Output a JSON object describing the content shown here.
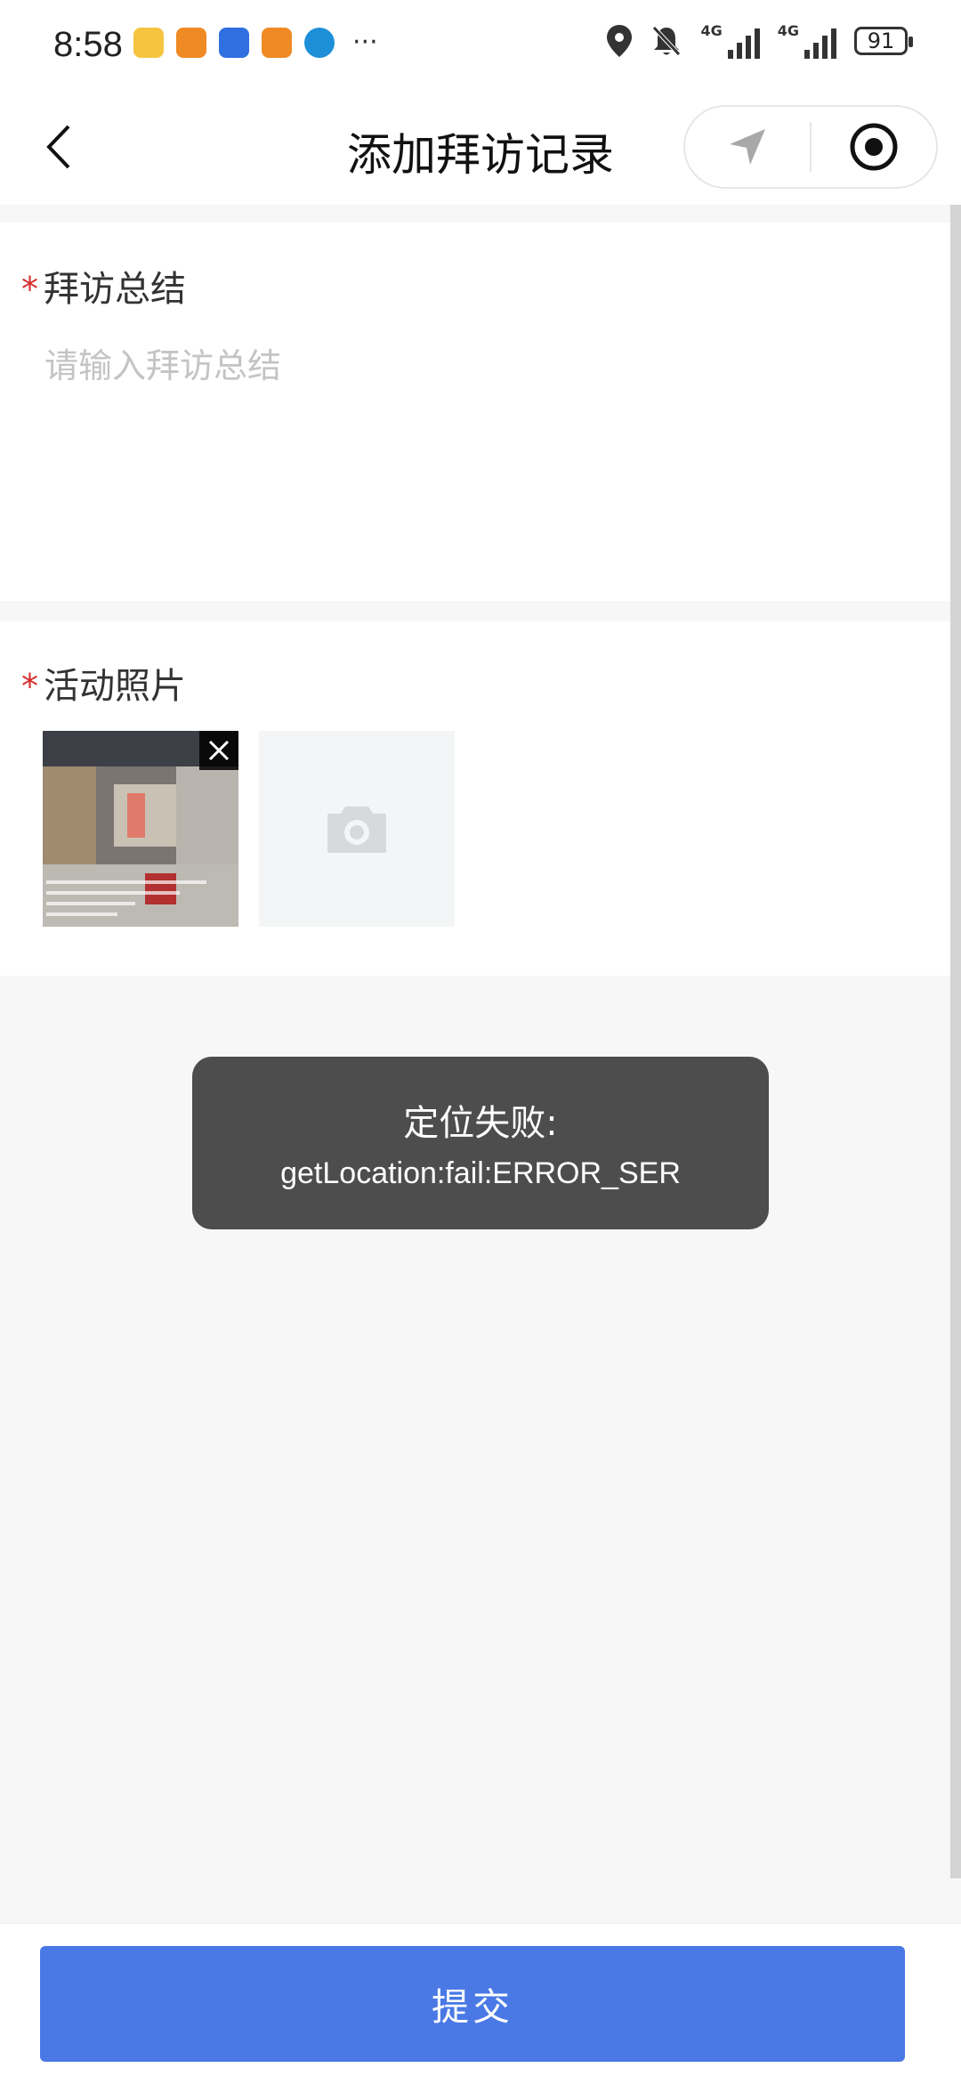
{
  "status_bar": {
    "time": "8:58",
    "network_1": "4G",
    "network_2": "4G",
    "battery": "91",
    "more_indicator": "···",
    "notification_icons": [
      {
        "name": "meituan-app-icon",
        "color": "#f5c542"
      },
      {
        "name": "taobao-app-icon",
        "color": "#f08a24"
      },
      {
        "name": "voice-app-icon",
        "color": "#2f6fe0"
      },
      {
        "name": "taobao-app-icon",
        "color": "#f08a24"
      },
      {
        "name": "browser-app-icon",
        "color": "#1d8fd8"
      }
    ]
  },
  "nav": {
    "title": "添加拜访记录"
  },
  "summary": {
    "required_mark": "*",
    "label": "拜访总结",
    "placeholder": "请输入拜访总结"
  },
  "photos": {
    "required_mark": "*",
    "label": "活动照片"
  },
  "toast": {
    "title": "定位失败:",
    "message": "getLocation:fail:ERROR_SER"
  },
  "footer": {
    "submit_label": "提交"
  },
  "colors": {
    "accent": "#4a79e6",
    "required": "#d62d2d",
    "toast_bg": "#4d4d4d"
  }
}
